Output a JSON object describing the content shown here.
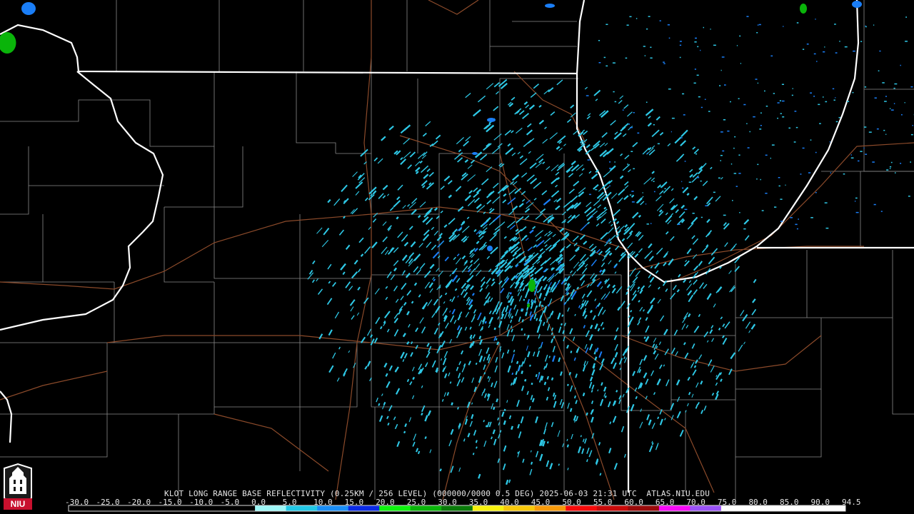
{
  "header": {
    "caption": "KLOT LONG RANGE BASE REFLECTIVITY (0.25KM / 256 LEVEL) (000000/0000 0.5 DEG) 2025-06-03 21:31 UTC  ATLAS.NIU.EDU"
  },
  "logo": {
    "text": "NIU",
    "color": "#c8102e"
  },
  "scale": {
    "labels": [
      "-30.0",
      "-25.0",
      "-20.0",
      "-15.0",
      "-10.0",
      "-5.0",
      "0.0",
      "5.0",
      "10.0",
      "15.0",
      "20.0",
      "25.0",
      "30.0",
      "35.0",
      "40.0",
      "45.0",
      "50.0",
      "55.0",
      "60.0",
      "65.0",
      "70.0",
      "75.0",
      "80.0",
      "85.0",
      "90.0",
      "94.5"
    ],
    "colors": [
      "#000000",
      "#000000",
      "#000000",
      "#000000",
      "#000000",
      "#000000",
      "#9ef7f7",
      "#22c8e6",
      "#1a8ef7",
      "#0a2ae6",
      "#0ef20e",
      "#0ab40a",
      "#0a7a0a",
      "#f7f20e",
      "#f7c80a",
      "#f79a0a",
      "#f70a0a",
      "#c80a0a",
      "#9a0a0a",
      "#f70af7",
      "#9a52f7",
      "#ffffff",
      "#ffffff",
      "#ffffff",
      "#ffffff"
    ]
  },
  "colors": {
    "background": "#000000",
    "state_lines": "#ffffff",
    "county_lines": "#8a8a8a",
    "roads": "#8b4a2a",
    "echo_light": "#2ec8e6",
    "echo_mid": "#1a7ef7",
    "echo_strong": "#0ab40a"
  }
}
